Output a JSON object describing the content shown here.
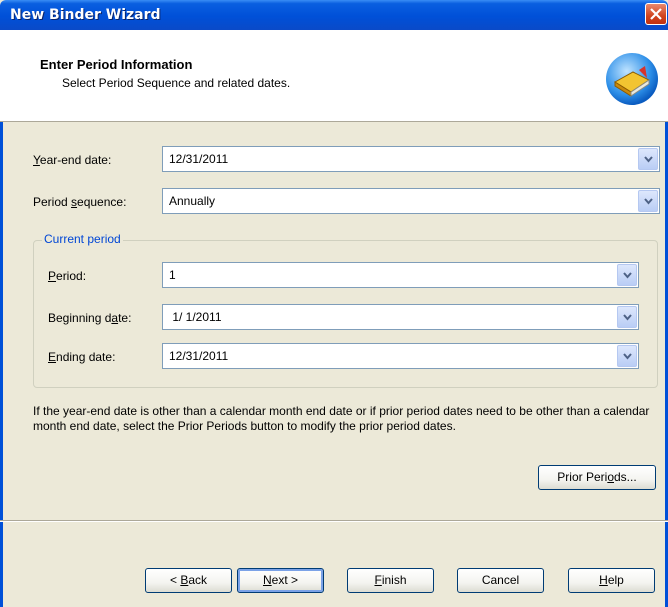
{
  "window": {
    "title": "New Binder Wizard"
  },
  "header": {
    "title": "Enter Period Information",
    "subtitle": "Select Period Sequence and related dates."
  },
  "fields": {
    "year_end": {
      "label_pre": "",
      "label_u": "Y",
      "label_post": "ear-end date:",
      "value": "12/31/2011"
    },
    "period_sequence": {
      "label_pre": "Period ",
      "label_u": "s",
      "label_post": "equence:",
      "value": "Annually"
    }
  },
  "current_period": {
    "legend": "Current period",
    "period": {
      "label_pre": "",
      "label_u": "P",
      "label_post": "eriod:",
      "value": "1"
    },
    "beginning_date": {
      "label_pre": "Beginning d",
      "label_u": "a",
      "label_post": "te:",
      "value": " 1/ 1/2011"
    },
    "ending_date": {
      "label_pre": "",
      "label_u": "E",
      "label_post": "nding date:",
      "value": "12/31/2011"
    }
  },
  "info_text": "If the year-end date is other than a calendar month end date or if prior period dates need to be other than a calendar month end date, select the Prior Periods button to modify the prior period dates.",
  "buttons": {
    "prior_periods": {
      "pre": "Prior Peri",
      "u": "o",
      "post": "ds..."
    },
    "back": {
      "pre": "< ",
      "u": "B",
      "post": "ack"
    },
    "next": {
      "pre": "",
      "u": "N",
      "post": "ext >"
    },
    "finish": {
      "pre": "",
      "u": "F",
      "post": "inish"
    },
    "cancel": {
      "label": "Cancel"
    },
    "help": {
      "pre": "",
      "u": "H",
      "post": "elp"
    }
  },
  "icons": {
    "close": "close-icon",
    "wizard": "binder-book-icon",
    "dropdown": "chevron-down-icon"
  }
}
